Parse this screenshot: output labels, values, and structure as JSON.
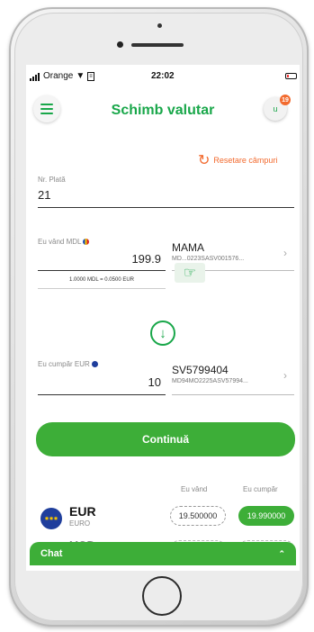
{
  "status_bar": {
    "carrier": "Orange",
    "time": "22:02"
  },
  "header": {
    "title": "Schimb valutar",
    "avatar_initial": "u",
    "notification_count": "19"
  },
  "reset_label": "Resetare câmpuri",
  "payment": {
    "label": "Nr. Plată",
    "value": "21"
  },
  "sell": {
    "label": "Eu vând MDL",
    "amount": "199.9",
    "account_name": "MAMA",
    "account_iban": "MD...0223SASV001576...",
    "rate_text": "1.0000 MDL = 0.0500 EUR"
  },
  "buy": {
    "label": "Eu cumpăr EUR",
    "amount": "10",
    "account_name": "SV5799404",
    "account_iban": "MD94MO2225ASV57994..."
  },
  "continue_label": "Continuă",
  "rates": {
    "sell_header": "Eu vând",
    "buy_header": "Eu cumpăr",
    "rows": [
      {
        "code": "EUR",
        "name": "EURO",
        "sell": "19.500000",
        "buy": "19.990000"
      },
      {
        "code": "USD",
        "name": "",
        "sell": "",
        "buy": ""
      }
    ]
  },
  "chat_label": "Chat",
  "colors": {
    "brand": "#3dae38",
    "accent": "#f26a2e"
  }
}
